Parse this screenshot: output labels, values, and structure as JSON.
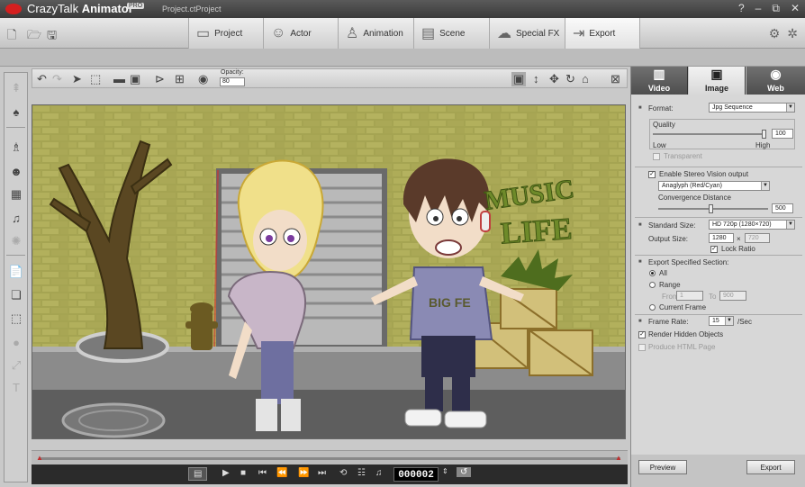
{
  "titlebar": {
    "app_name_1": "CrazyTalk ",
    "app_name_2": "Animator",
    "badge": "PRO",
    "project": "Project.ctProject",
    "controls": [
      "?",
      "–",
      "⧉",
      "✕"
    ]
  },
  "tabs": [
    {
      "label": "Project",
      "icon": "project-icon",
      "glyph": "▭"
    },
    {
      "label": "Actor",
      "icon": "actor-icon",
      "glyph": "☺"
    },
    {
      "label": "Animation",
      "icon": "animation-icon",
      "glyph": "♙"
    },
    {
      "label": "Scene",
      "icon": "scene-icon",
      "glyph": "▤"
    },
    {
      "label": "Special FX",
      "icon": "special-fx-icon",
      "glyph": "☁"
    },
    {
      "label": "Export",
      "icon": "export-icon",
      "glyph": "⇥"
    }
  ],
  "toolbar": {
    "opacity_label": "Opacity:",
    "opacity_value": "80"
  },
  "scene": {
    "graffiti_1": "MUSIC",
    "graffiti_2": "LIFE",
    "shirt": "BIG FE"
  },
  "player": {
    "frame": "000002"
  },
  "panel": {
    "tabs": [
      {
        "label": "Video",
        "icon": "video-icon",
        "glyph": "▥"
      },
      {
        "label": "Image",
        "icon": "image-icon",
        "glyph": "▣"
      },
      {
        "label": "Web",
        "icon": "web-icon",
        "glyph": "◉"
      }
    ],
    "format_label": "Format:",
    "format_value": "Jpg Sequence",
    "quality_label": "Quality",
    "quality_value": "100",
    "quality_low": "Low",
    "quality_high": "High",
    "transparent": "Transparent",
    "stereo_label": "Enable Stereo Vision output",
    "stereo_mode": "Anaglyph (Red/Cyan)",
    "convergence_label": "Convergence Distance",
    "convergence_value": "500",
    "standard_size_label": "Standard Size:",
    "standard_size_value": "HD 720p (1280×720)",
    "output_size_label": "Output Size:",
    "output_w": "1280",
    "output_x": "×",
    "output_h": "720",
    "lock_ratio": "Lock Ratio",
    "section_label": "Export Specified Section:",
    "opt_all": "All",
    "opt_range": "Range",
    "from_label": "From",
    "from_value": "1",
    "to_label": "To",
    "to_value": "900",
    "opt_current": "Current Frame",
    "frame_rate_label": "Frame Rate:",
    "frame_rate_value": "15",
    "frame_rate_unit": "/Sec",
    "render_hidden": "Render Hidden Objects",
    "produce_html": "Produce HTML Page",
    "preview_button": "Preview",
    "export_button": "Export"
  }
}
